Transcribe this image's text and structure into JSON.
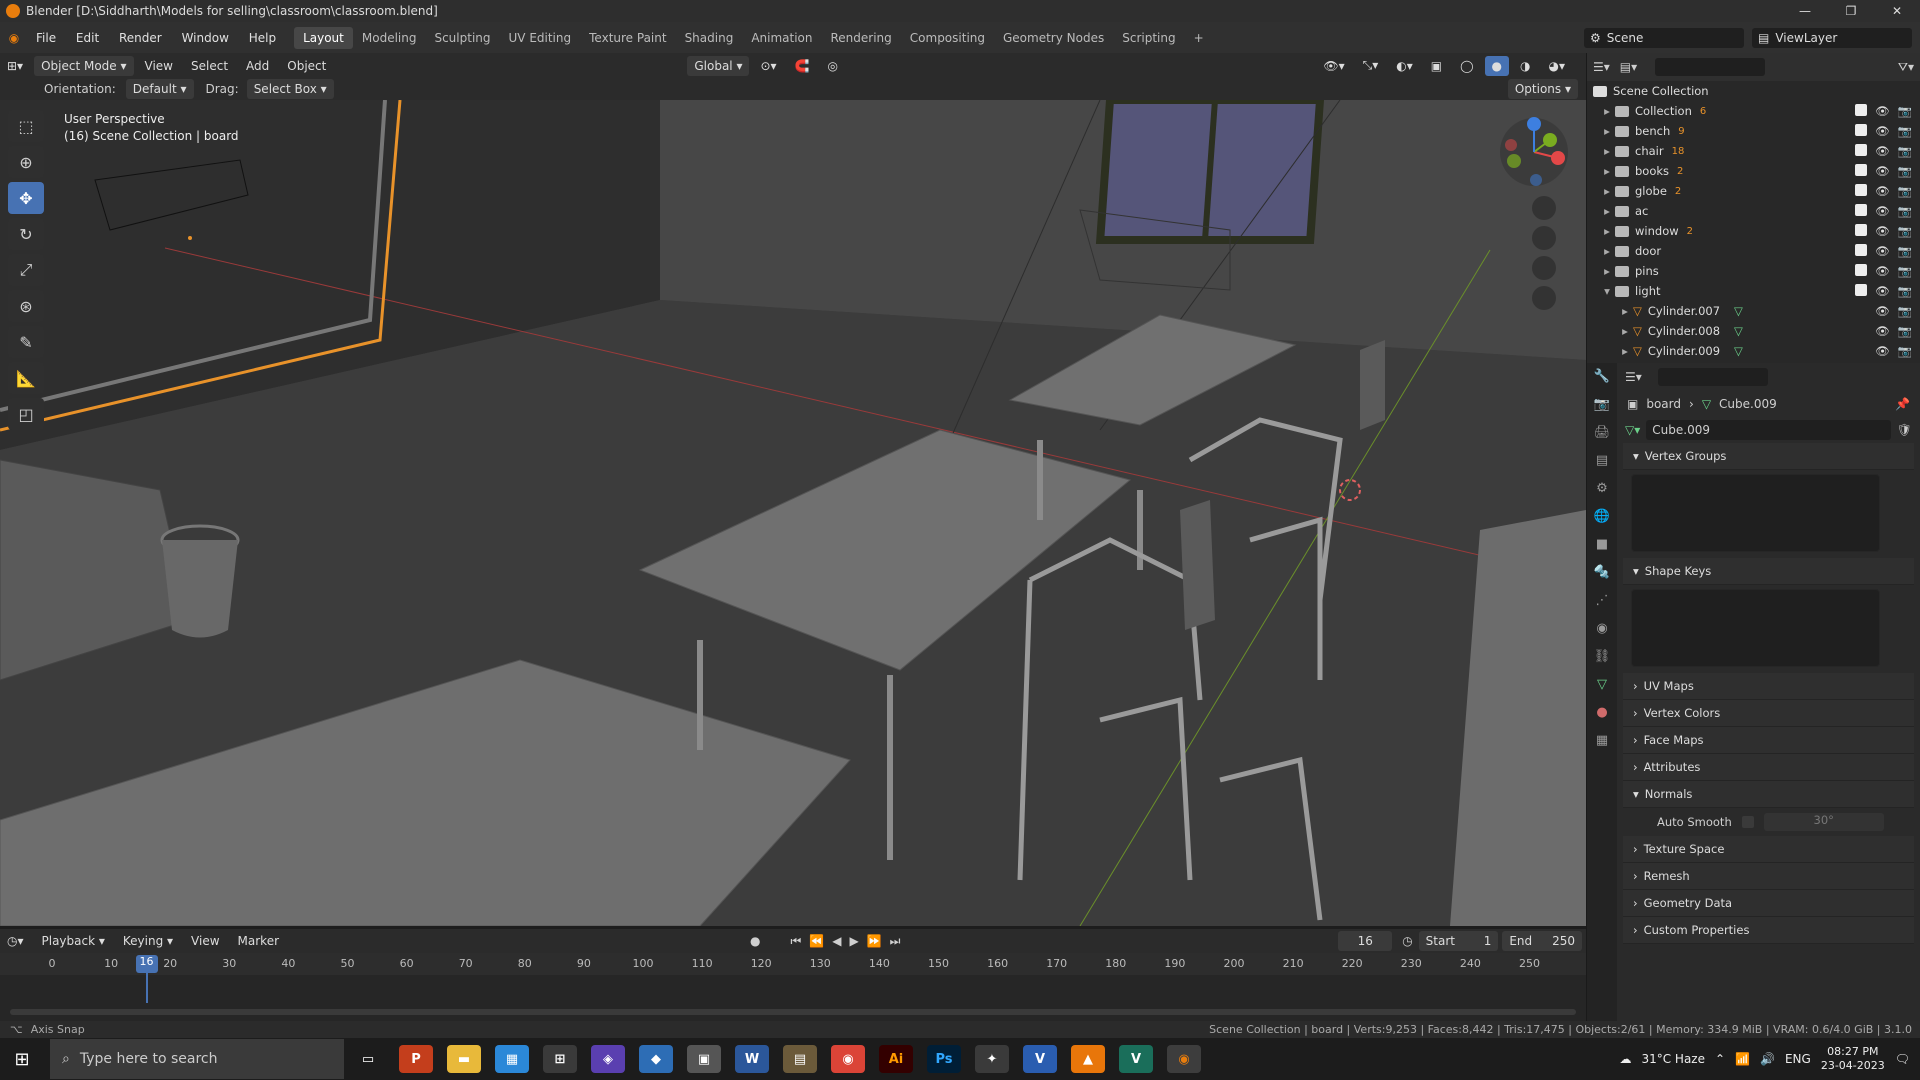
{
  "window": {
    "title": "Blender [D:\\Siddharth\\Models for selling\\classroom\\classroom.blend]"
  },
  "menu": [
    "File",
    "Edit",
    "Render",
    "Window",
    "Help"
  ],
  "workspaces": [
    "Layout",
    "Modeling",
    "Sculpting",
    "UV Editing",
    "Texture Paint",
    "Shading",
    "Animation",
    "Rendering",
    "Compositing",
    "Geometry Nodes",
    "Scripting",
    "+"
  ],
  "scene": {
    "name": "Scene",
    "view_layer": "ViewLayer"
  },
  "viewport_header": {
    "mode": "Object Mode",
    "view": "View",
    "select": "Select",
    "add": "Add",
    "object": "Object",
    "transform": "Global"
  },
  "tool_header": {
    "orientation_label": "Orientation:",
    "orientation": "Default",
    "drag_label": "Drag:",
    "drag": "Select Box",
    "options": "Options"
  },
  "viewport": {
    "perspective": "User Perspective",
    "collection_info": "(16) Scene Collection | board"
  },
  "outliner": {
    "root": "Scene Collection",
    "items": [
      {
        "name": "Collection",
        "badge": "6",
        "expanded": false
      },
      {
        "name": "bench",
        "badge": "9",
        "expanded": false
      },
      {
        "name": "chair",
        "badge": "18",
        "expanded": false
      },
      {
        "name": "books",
        "badge": "2",
        "expanded": false
      },
      {
        "name": "globe",
        "badge": "2",
        "expanded": false
      },
      {
        "name": "ac",
        "badge": "",
        "expanded": false
      },
      {
        "name": "window",
        "badge": "2",
        "expanded": false
      },
      {
        "name": "door",
        "badge": "",
        "expanded": false
      },
      {
        "name": "pins",
        "badge": "",
        "expanded": false
      },
      {
        "name": "light",
        "badge": "",
        "expanded": true
      }
    ],
    "children": [
      "Cylinder.007",
      "Cylinder.008",
      "Cylinder.009"
    ]
  },
  "properties": {
    "breadcrumb_object": "board",
    "breadcrumb_mesh": "Cube.009",
    "mesh_name": "Cube.009",
    "panels": [
      "Vertex Groups",
      "Shape Keys",
      "UV Maps",
      "Vertex Colors",
      "Face Maps",
      "Attributes",
      "Normals",
      "Texture Space",
      "Remesh",
      "Geometry Data",
      "Custom Properties"
    ],
    "auto_smooth_label": "Auto Smooth",
    "auto_smooth_angle": "30°"
  },
  "timeline": {
    "playback": "Playback",
    "keying": "Keying",
    "view": "View",
    "marker": "Marker",
    "current_frame": "16",
    "start_label": "Start",
    "start": "1",
    "end_label": "End",
    "end": "250",
    "ticks": [
      "0",
      "10",
      "20",
      "30",
      "40",
      "50",
      "60",
      "70",
      "80",
      "90",
      "100",
      "110",
      "120",
      "130",
      "140",
      "150",
      "160",
      "170",
      "180",
      "190",
      "200",
      "210",
      "220",
      "230",
      "240",
      "250"
    ]
  },
  "statusbar": {
    "left": "Axis Snap",
    "right": "Scene Collection | board | Verts:9,253 | Faces:8,442 | Tris:17,475 | Objects:2/61 | Memory: 334.9 MiB | VRAM: 0.6/4.0 GiB | 3.1.0"
  },
  "taskbar": {
    "search_placeholder": "Type here to search",
    "weather": "31°C  Haze",
    "lang": "ENG",
    "time": "08:27 PM",
    "date": "23-04-2023"
  }
}
